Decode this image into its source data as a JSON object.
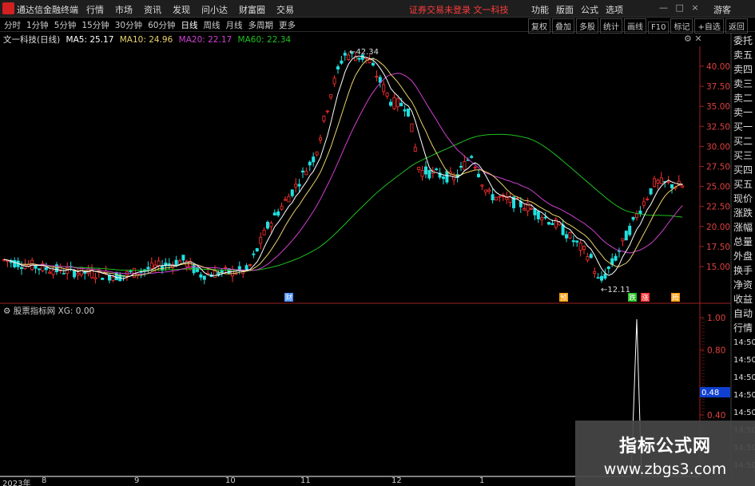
{
  "titlebar": {
    "app_name": "通达信金融终端",
    "menus": [
      "行情",
      "市场",
      "资讯",
      "发现",
      "问小达",
      "财富圈",
      "交易"
    ],
    "account_notice": "证券交易未登录  文一科技",
    "right_menus": [
      "功能",
      "版面",
      "公式",
      "选项"
    ],
    "guest": "游客"
  },
  "toolbar": {
    "periods": [
      "分时",
      "1分钟",
      "5分钟",
      "15分钟",
      "30分钟",
      "60分钟",
      "日线",
      "周线",
      "月线",
      "多周期",
      "更多"
    ],
    "active_period": "日线",
    "tools": [
      "复权",
      "叠加",
      "多股",
      "统计",
      "画线",
      "F10",
      "标记",
      "+自选",
      "返回"
    ]
  },
  "legend": {
    "stock": "文一科技(日线)",
    "ma5": "MA5: 25.17",
    "ma10": "MA10: 24.96",
    "ma20": "MA20: 22.17",
    "ma60": "MA60: 22.34"
  },
  "colors": {
    "ma5": "#ffffff",
    "ma10": "#e8d26a",
    "ma20": "#d040d0",
    "ma60": "#20c020",
    "up": "#ff3030",
    "down": "#20e0e0"
  },
  "right_labels": [
    "委托",
    "卖五",
    "卖四",
    "卖三",
    "卖二",
    "卖一",
    "买一",
    "买二",
    "买三",
    "买四",
    "买五",
    "现价",
    "涨跌",
    "涨幅",
    "总量",
    "外盘",
    "换手",
    "净资",
    "收益"
  ],
  "right_labels2": [
    "自动",
    "行情"
  ],
  "price_axis": [
    "40.00",
    "37.50",
    "35.00",
    "32.50",
    "30.00",
    "27.50",
    "25.00",
    "22.50",
    "20.00",
    "17.50",
    "15.00"
  ],
  "annotations": {
    "high": "42.34",
    "low": "12.11",
    "events": [
      {
        "label": "财",
        "color": "#4a90ff"
      },
      {
        "label": "预",
        "color": "#ff9900"
      },
      {
        "label": "跌",
        "color": "#20c020"
      },
      {
        "label": "涨",
        "color": "#ff3030"
      },
      {
        "label": "腾",
        "color": "#ff9900"
      }
    ]
  },
  "lower": {
    "title": "股票指标网 XG: 0.00",
    "axis": [
      "1.00",
      "0.80",
      "0.40"
    ],
    "current": "0.48",
    "time_labels": [
      "14:50",
      "14:50",
      "14:50",
      "14:50",
      "14:50",
      "14:50",
      "14:50",
      "14:50"
    ]
  },
  "dates": [
    "2023年",
    "8",
    "9",
    "10",
    "11",
    "12",
    "1"
  ],
  "watermark": {
    "title": "指标公式网",
    "url": "www.zbgs3.com"
  }
}
